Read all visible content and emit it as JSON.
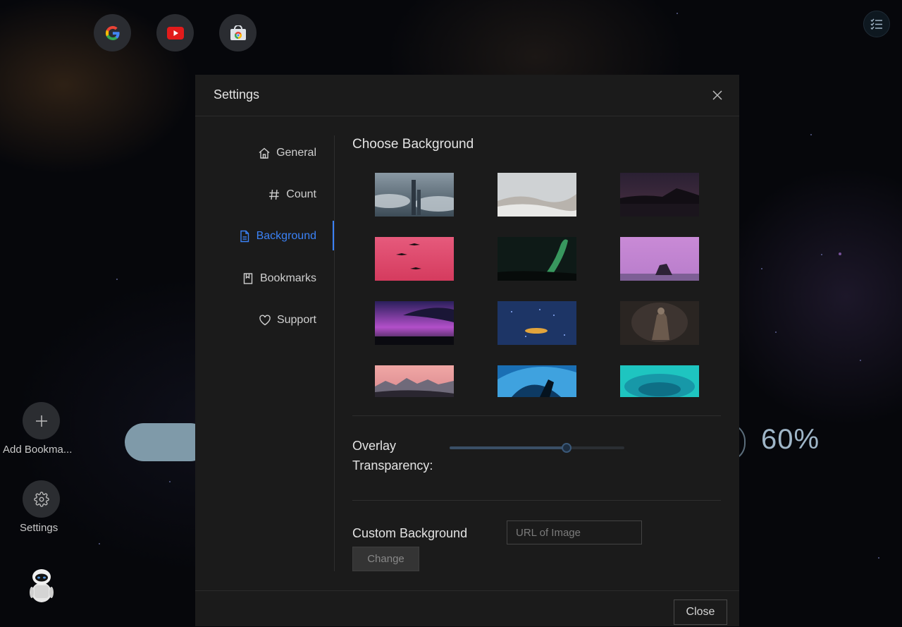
{
  "shortcuts": [
    {
      "icon": "google-icon"
    },
    {
      "icon": "youtube-icon"
    },
    {
      "icon": "chrome-web-store-icon"
    }
  ],
  "top_right": {
    "icon": "checklist-icon"
  },
  "dock": {
    "add_bookmark_label": "Add Bookma...",
    "settings_label": "Settings"
  },
  "background_widget": {
    "percent": "60%"
  },
  "modal": {
    "title": "Settings",
    "nav": [
      {
        "label": "General",
        "icon": "home-icon"
      },
      {
        "label": "Count",
        "icon": "hash-icon"
      },
      {
        "label": "Background",
        "icon": "document-icon",
        "active": true
      },
      {
        "label": "Bookmarks",
        "icon": "bookmark-icon"
      },
      {
        "label": "Support",
        "icon": "heart-icon"
      }
    ],
    "choose_background": {
      "title": "Choose Background",
      "thumbnails": [
        "city-clouds-thumbnail",
        "snowy-hills-thumbnail",
        "night-lake-thumbnail",
        "pink-sky-birds-thumbnail",
        "aurora-green-thumbnail",
        "purple-sea-rock-thumbnail",
        "purple-sunset-thumbnail",
        "night-city-lights-thumbnail",
        "dark-figure-thumbnail",
        "pink-mountains-thumbnail",
        "blue-wave-surfer-thumbnail",
        "teal-swirl-thumbnail"
      ]
    },
    "overlay": {
      "label_line1": "Overlay",
      "label_line2": "Transparency:",
      "value": 0.67
    },
    "custom_background": {
      "label": "Custom Background",
      "placeholder": "URL of Image",
      "value": "",
      "change_label": "Change"
    },
    "close_label": "Close"
  },
  "colors": {
    "accent": "#3b82f6",
    "modal_bg": "#1b1b1b"
  }
}
